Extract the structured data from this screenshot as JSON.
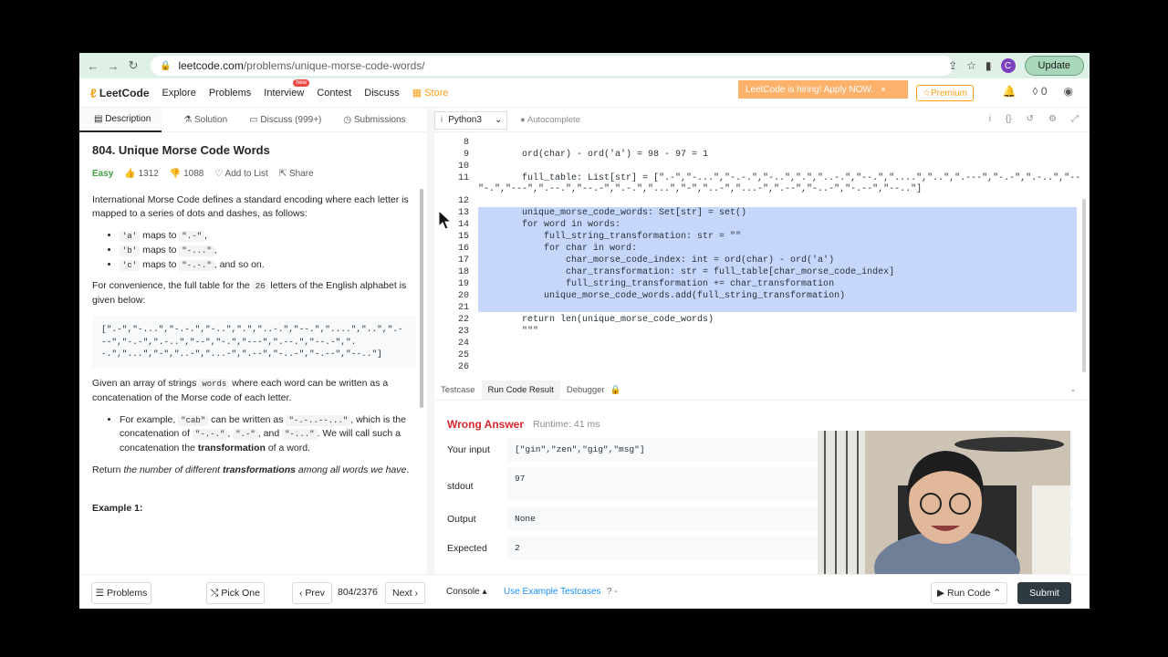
{
  "browser": {
    "url_host": "leetcode.com",
    "url_path": "/problems/unique-morse-code-words/",
    "avatar_letter": "C",
    "update_label": "Update"
  },
  "nav": {
    "logo": "LeetCode",
    "links": [
      "Explore",
      "Problems",
      "Interview",
      "Contest",
      "Discuss",
      "Store"
    ],
    "new_badge": "New",
    "hiring": "LeetCode is hiring! Apply NOW.",
    "premium": "Premium",
    "coins": "0"
  },
  "left_tabs": [
    "Description",
    "Solution",
    "Discuss (999+)",
    "Submissions"
  ],
  "problem": {
    "title": "804. Unique Morse Code Words",
    "difficulty": "Easy",
    "likes": "1312",
    "dislikes": "1088",
    "add_to_list": "Add to List",
    "share": "Share",
    "p1": "International Morse Code defines a standard encoding where each letter is mapped to a series of dots and dashes, as follows:",
    "bullets": [
      {
        "code1": "'a'",
        "mid": " maps to ",
        "code2": "\".-\"",
        "tail": ","
      },
      {
        "code1": "'b'",
        "mid": " maps to ",
        "code2": "\"-...\"",
        "tail": ","
      },
      {
        "code1": "'c'",
        "mid": " maps to ",
        "code2": "\"-.-.\"",
        "tail": ", and so on."
      }
    ],
    "p2_a": "For convenience, the full table for the ",
    "p2_code": "26",
    "p2_b": " letters of the English alphabet is given below:",
    "table": "[\".-\",\"-...\",\"-.-.\",\"-..\",\".\",\"..-.\",\"--.\",\"....\",\"..\",\".---\",\"-.-\",\".-..\",\"--\",\"-.\",\"---\",\".--.\",\"--.-\",\".-.\",\"...\",\"-\",\"..-\",\"...-\",\".--\",\"-..-\",\"-.--\",\"--..\"]",
    "p3_a": "Given an array of strings ",
    "p3_code": "words",
    "p3_b": " where each word can be written as a concatenation of the Morse code of each letter.",
    "ex_a": "For example, ",
    "ex_c1": "\"cab\"",
    "ex_b": " can be written as ",
    "ex_c2": "\"-.-..--...\"",
    "ex_c": ", which is the concatenation of ",
    "ex_c3": "\"-.-.\"",
    "ex_d": ", ",
    "ex_c4": "\".-\"",
    "ex_e": ", and ",
    "ex_c5": "\"-...\"",
    "ex_f": ". We will call such a concatenation the ",
    "ex_bold": "transformation",
    "ex_g": " of a word.",
    "ret_a": "Return ",
    "ret_i1": "the number of different ",
    "ret_bold": "transformations",
    "ret_i2": " among all words we have",
    "ret_end": ".",
    "example_heading": "Example 1:"
  },
  "editor": {
    "language": "Python3",
    "autocomplete": "Autocomplete",
    "lines": [
      {
        "n": "8",
        "t": ""
      },
      {
        "n": "9",
        "t": "        ord(char) - ord('a') = 98 - 97 = 1"
      },
      {
        "n": "10",
        "t": ""
      },
      {
        "n": "11",
        "t": "        full_table: List[str] = [\".-\",\"-...\",\"-.-.\",\"-..\",\".\",\"..-.\",\"--.\",\"....\",\"..\",\".---\",\"-.-\",\".-..\",\"--"
      },
      {
        "n": "",
        "t": "\"-.\",\"---\",\".--.\",\"--.-\",\".-.\",\"...\",\"-\",\"..-\",\"...-\",\".--\",\"-..-\",\"-.--\",\"--..\"]"
      },
      {
        "n": "12",
        "t": ""
      },
      {
        "n": "13",
        "t": "        unique_morse_code_words: Set[str] = set()"
      },
      {
        "n": "14",
        "t": "        for word in words:"
      },
      {
        "n": "15",
        "t": "            full_string_transformation: str = \"\""
      },
      {
        "n": "16",
        "t": "            for char in word:"
      },
      {
        "n": "17",
        "t": "                char_morse_code_index: int = ord(char) - ord('a')"
      },
      {
        "n": "18",
        "t": "                char_transformation: str = full_table[char_morse_code_index]"
      },
      {
        "n": "19",
        "t": "                full_string_transformation += char_transformation"
      },
      {
        "n": "20",
        "t": "            unique_morse_code_words.add(full_string_transformation)"
      },
      {
        "n": "21",
        "t": ""
      },
      {
        "n": "22",
        "t": "        return len(unique_morse_code_words)"
      },
      {
        "n": "23",
        "t": "        \"\"\""
      },
      {
        "n": "24",
        "t": ""
      },
      {
        "n": "25",
        "t": ""
      },
      {
        "n": "26",
        "t": ""
      }
    ]
  },
  "result_tabs": [
    "Testcase",
    "Run Code Result",
    "Debugger"
  ],
  "result": {
    "status": "Wrong Answer",
    "runtime": "Runtime: 41 ms",
    "input_label": "Your input",
    "input": "[\"gin\",\"zen\",\"gig\",\"msg\"]",
    "stdout_label": "stdout",
    "stdout": "97",
    "output_label": "Output",
    "output": "None",
    "expected_label": "Expected",
    "expected": "2"
  },
  "bottom": {
    "problems": "Problems",
    "pick_one": "Pick One",
    "prev": "Prev",
    "page": "804/2376",
    "next": "Next",
    "console": "Console",
    "use_example": "Use Example Testcases",
    "run_code": "Run Code",
    "submit": "Submit"
  }
}
